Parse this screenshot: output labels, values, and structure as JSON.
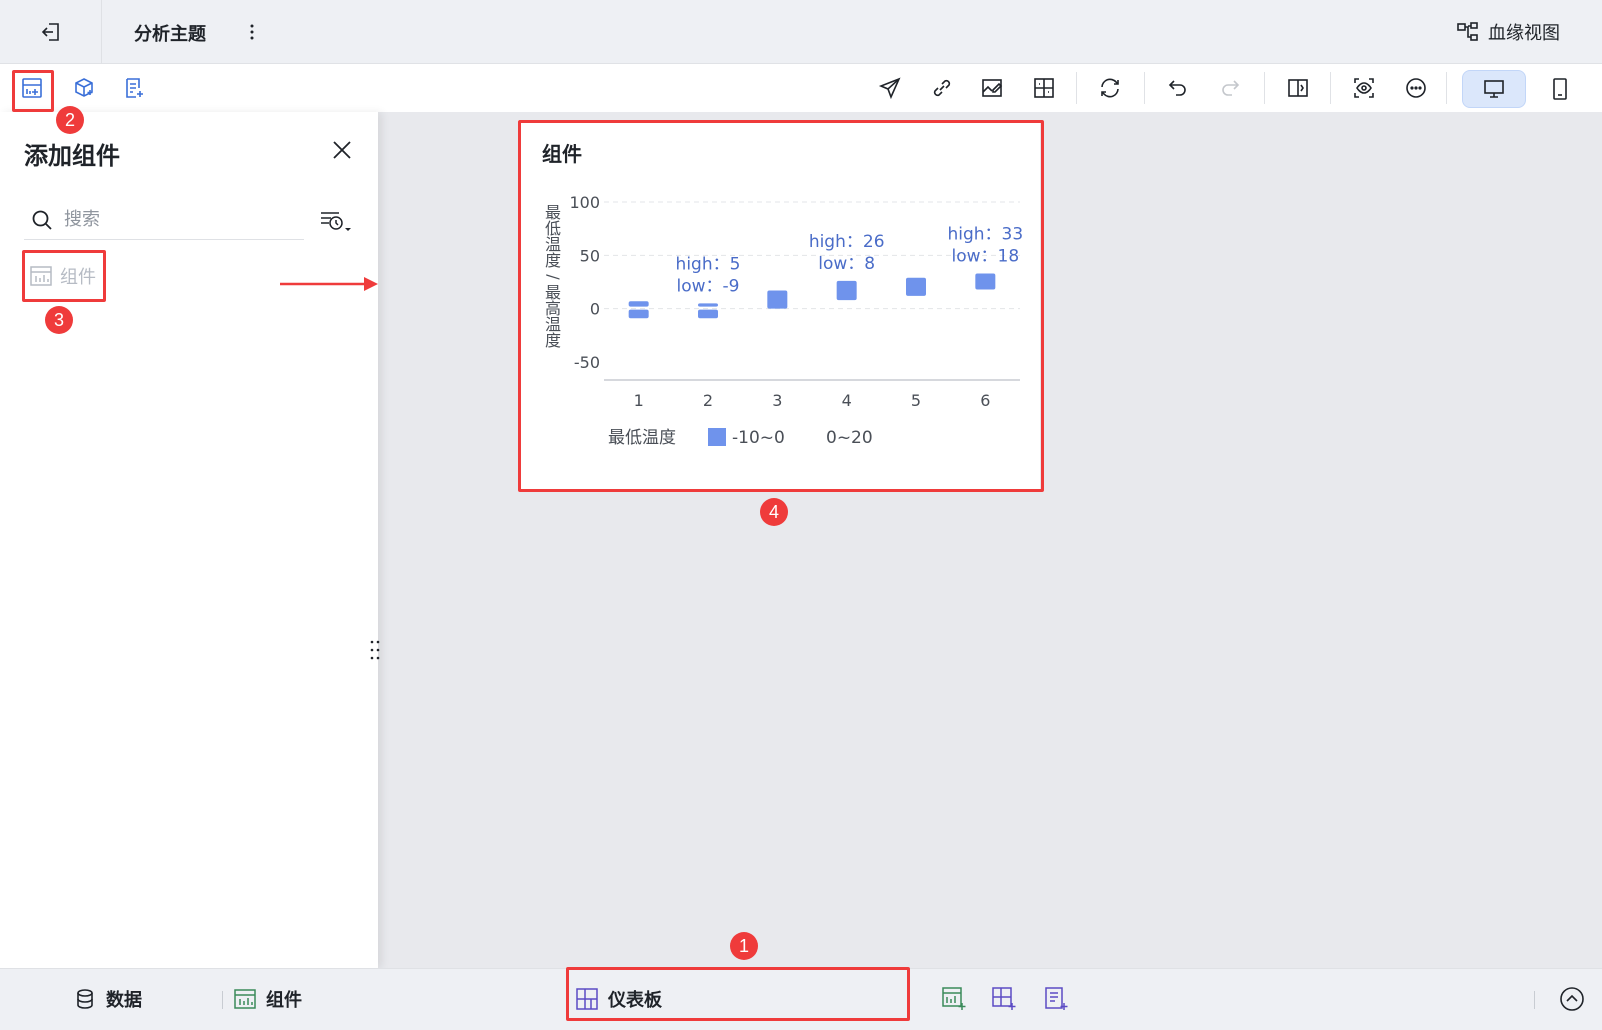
{
  "header": {
    "subject_title": "分析主题",
    "lineage_label": "血缘视图"
  },
  "panel": {
    "title": "添加组件",
    "search_placeholder": "搜索",
    "items": [
      {
        "label": "组件"
      }
    ]
  },
  "widget": {
    "title": "组件"
  },
  "chart_data": {
    "type": "bar",
    "subtype": "range-bar",
    "title": "组件",
    "ylabel": "最低温度/最高温度",
    "ylim": [
      -50,
      100
    ],
    "yticks": [
      "100",
      "50",
      "0",
      "-50"
    ],
    "categories": [
      "1",
      "2",
      "3",
      "4",
      "5",
      "6"
    ],
    "series": [
      {
        "name": "最低温度",
        "low": [
          -9,
          -9,
          0,
          8,
          12,
          18
        ],
        "high": [
          7,
          5,
          17,
          26,
          29,
          33
        ]
      }
    ],
    "labels": [
      {
        "category": "2",
        "high_text": "high：5",
        "low_text": "low：-9"
      },
      {
        "category": "4",
        "high_text": "high：26",
        "low_text": "low：8"
      },
      {
        "category": "6",
        "high_text": "high：33",
        "low_text": "low：18"
      }
    ],
    "legend": {
      "title": "最低温度",
      "items": [
        {
          "label": "-10~0",
          "color": "#6f93ec"
        },
        {
          "label": "0~20",
          "color": ""
        }
      ],
      "position": "bottom"
    },
    "grid": true,
    "bar_color": "#6f93ec"
  },
  "bottombar": {
    "data_tab": "数据",
    "component_tab": "组件",
    "dashboard_tab": "仪表板"
  },
  "annotations": [
    "1",
    "2",
    "3",
    "4"
  ],
  "colors": {
    "accent": "#3a6fd8",
    "annotation_red": "#ef3b3b",
    "canvas_bg": "#e8e9ed"
  }
}
